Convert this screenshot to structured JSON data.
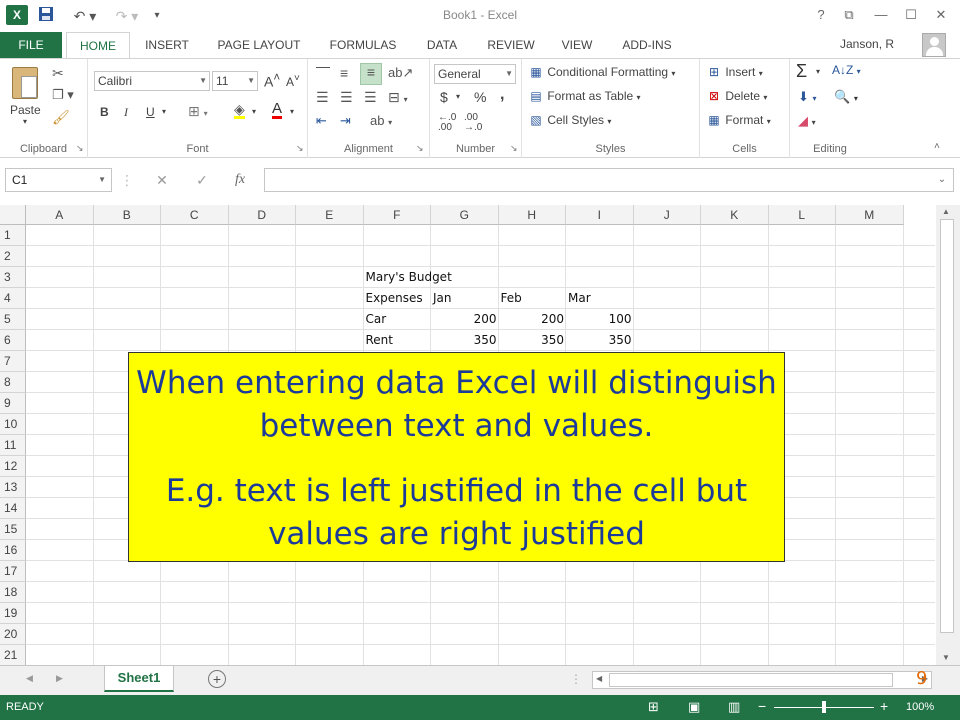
{
  "titlebar": {
    "app_icon": "X",
    "title": "Book1 - Excel",
    "help": "?",
    "restore_ribbon": "⧉",
    "minimize": "—",
    "maximize": "☐",
    "close": "✕"
  },
  "tabs": {
    "file": "FILE",
    "items": [
      "HOME",
      "INSERT",
      "PAGE LAYOUT",
      "FORMULAS",
      "DATA",
      "REVIEW",
      "VIEW",
      "ADD-INS"
    ],
    "active": "HOME",
    "user": "Janson, R"
  },
  "ribbon": {
    "clipboard": {
      "label": "Clipboard",
      "paste": "Paste"
    },
    "font": {
      "label": "Font",
      "name": "Calibri",
      "size": "11",
      "bold": "B",
      "italic": "I",
      "underline": "U"
    },
    "alignment": {
      "label": "Alignment"
    },
    "number": {
      "label": "Number",
      "format": "General",
      "currency": "$",
      "percent": "%",
      "comma": ","
    },
    "styles": {
      "label": "Styles",
      "conditional": "Conditional Formatting",
      "format_table": "Format as Table",
      "cell_styles": "Cell Styles"
    },
    "cells": {
      "label": "Cells",
      "insert": "Insert",
      "delete": "Delete",
      "format": "Format"
    },
    "editing": {
      "label": "Editing",
      "sum": "Σ"
    }
  },
  "formula_bar": {
    "name_box": "C1",
    "cancel": "✕",
    "enter": "✓",
    "fx": "fx",
    "content": ""
  },
  "grid": {
    "columns": [
      "A",
      "B",
      "C",
      "D",
      "E",
      "F",
      "G",
      "H",
      "I",
      "J",
      "K",
      "L",
      "M"
    ],
    "rows": [
      "1",
      "2",
      "3",
      "4",
      "5",
      "6",
      "7",
      "8",
      "9",
      "10",
      "11",
      "12",
      "13",
      "14",
      "15",
      "16",
      "17",
      "18",
      "19",
      "20",
      "21"
    ],
    "cells": {
      "F3": "Mary's Budget",
      "F4": "Expenses",
      "G4": "Jan",
      "H4": "Feb",
      "I4": "Mar",
      "F5": "Car",
      "G5": "200",
      "H5": "200",
      "I5": "100",
      "F6": "Rent",
      "G6": "350",
      "H6": "350",
      "I6": "350"
    }
  },
  "callout": {
    "line1": "When entering data Excel will distinguish between text and values.",
    "line2": "E.g. text is left justified in the cell but values are right justified",
    "page_number": "9"
  },
  "sheets": {
    "active": "Sheet1"
  },
  "status": {
    "mode": "READY",
    "zoom": "100%"
  }
}
